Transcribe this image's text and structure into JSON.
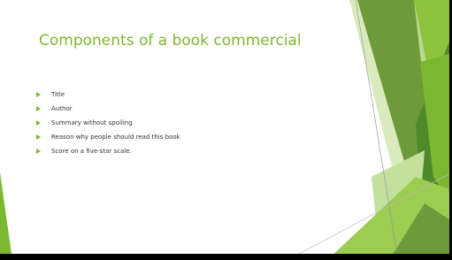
{
  "slide": {
    "title": "Components of a book commercial",
    "bullets": [
      "Title",
      "Author",
      "Summary without spoiling",
      "Reason why people should read this book",
      "Score on a five-star scale."
    ]
  },
  "theme": {
    "accent": "#7cb82f",
    "text": "#333333",
    "shape_greens": [
      "#6e9a3a",
      "#7cb82f",
      "#9ccc50",
      "#b8da8a",
      "#d7eab8",
      "#4f8a2a"
    ]
  },
  "icons": {
    "bullet": "triangle-right-icon"
  }
}
